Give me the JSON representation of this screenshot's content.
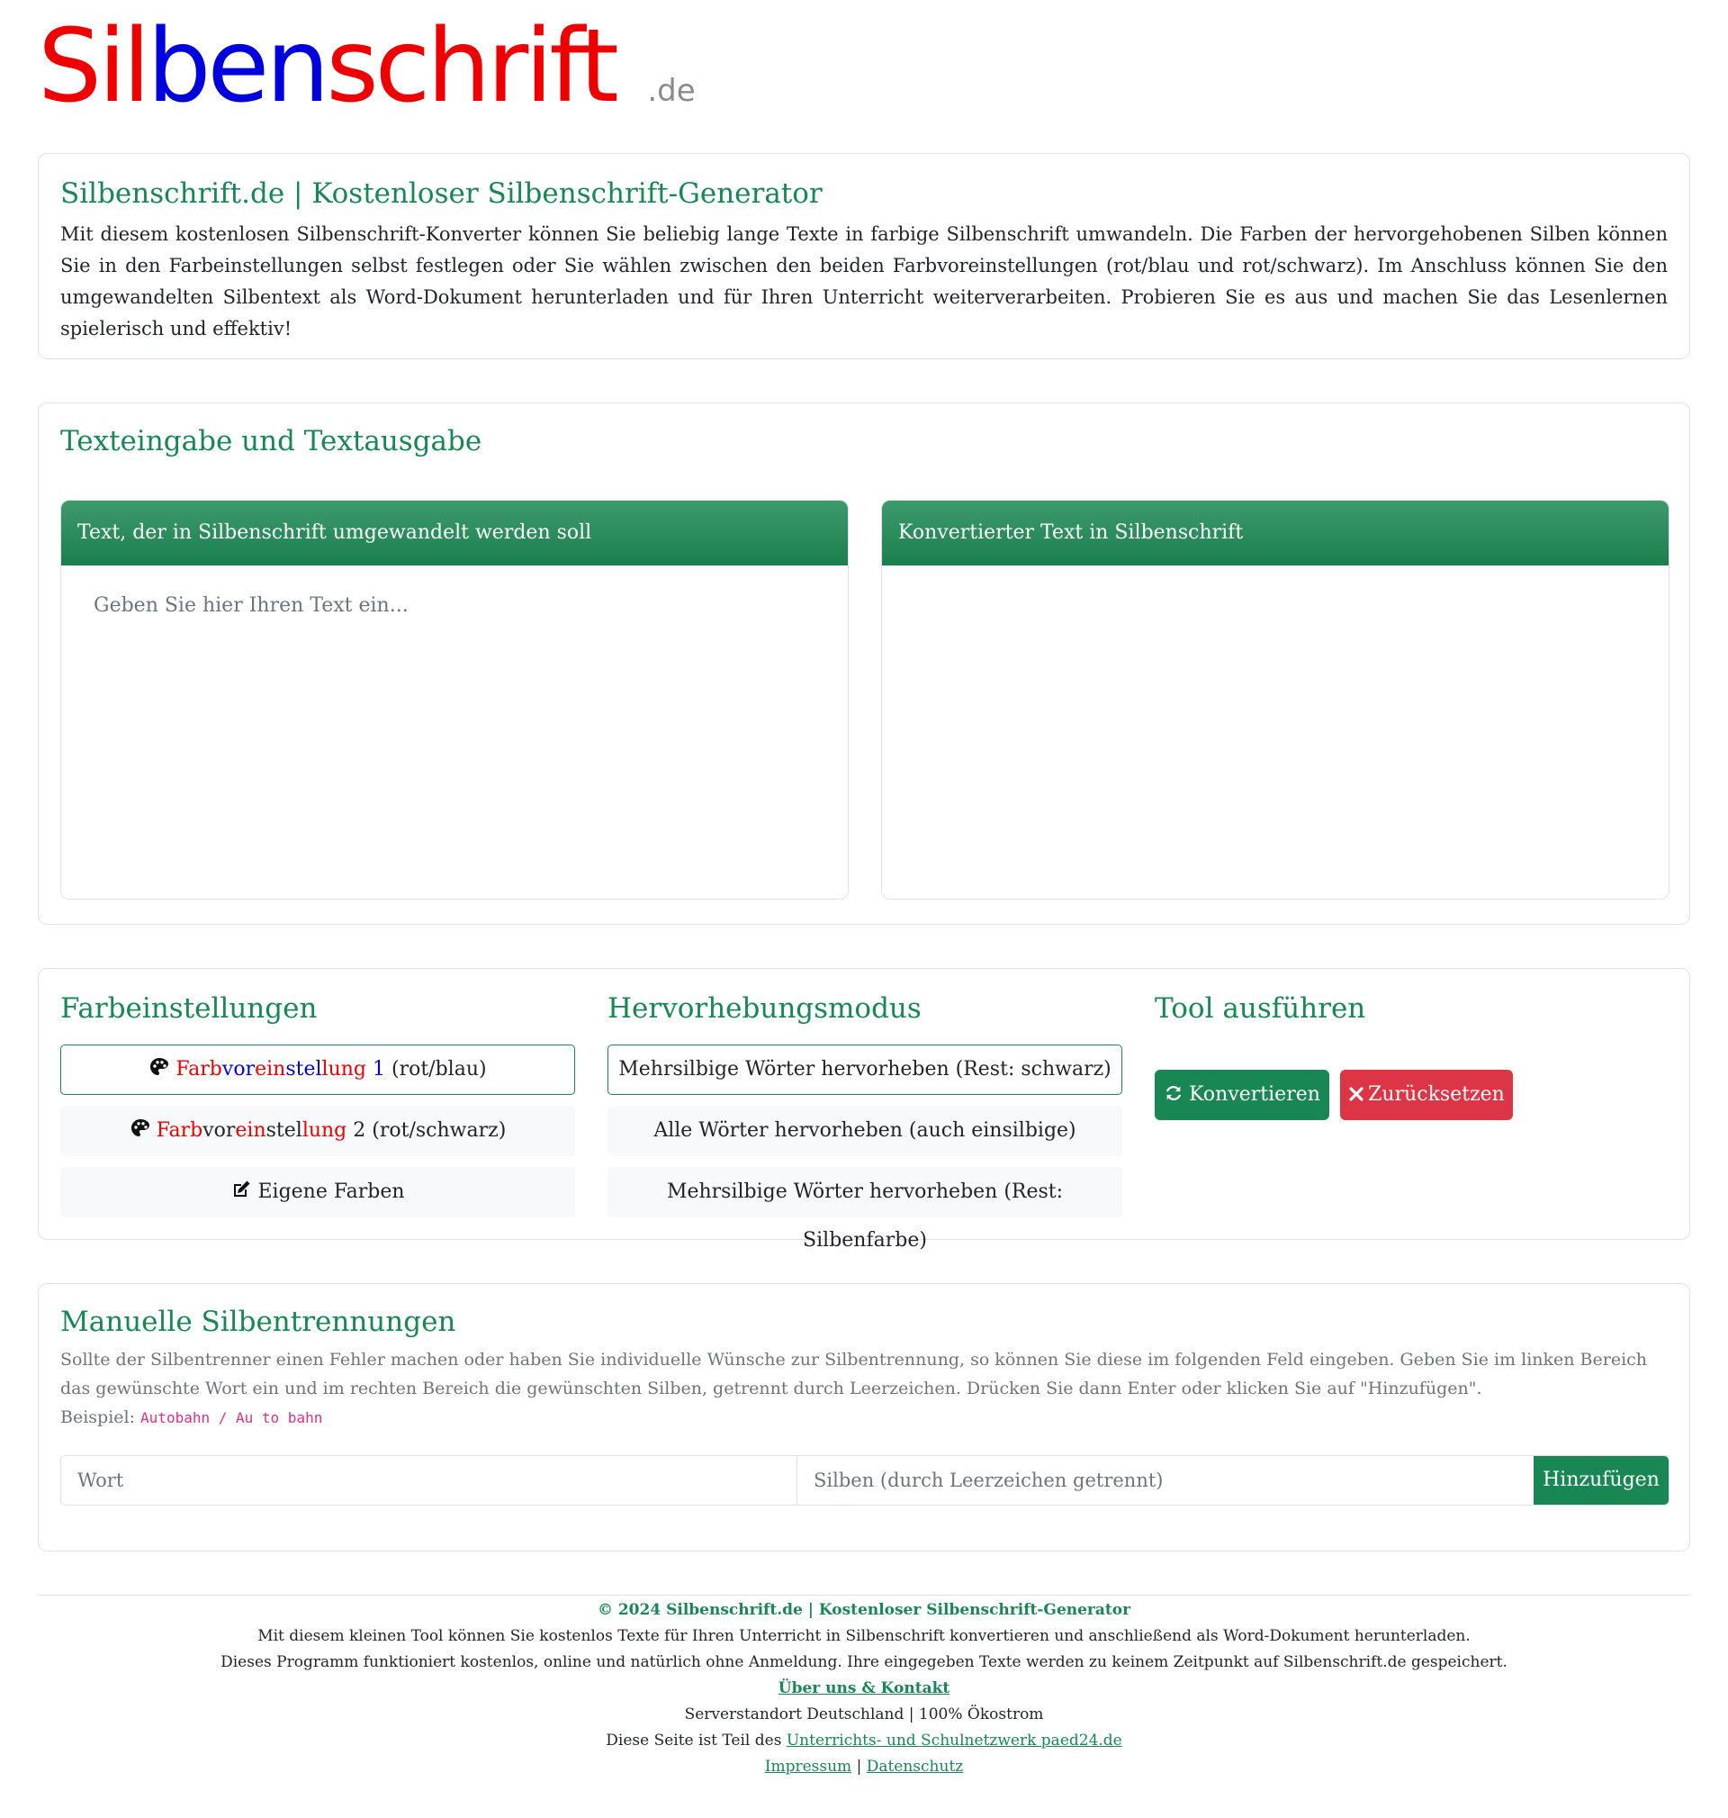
{
  "logo": {
    "syllables": [
      "Sil",
      "ben",
      "schrift"
    ],
    "tld": ".de"
  },
  "intro": {
    "title": "Silbenschrift.de | Kostenloser Silbenschrift-Generator",
    "text": "Mit diesem kostenlosen Silbenschrift-Konverter können Sie beliebig lange Texte in farbige Silbenschrift umwandeln. Die Farben der hervorgehobenen Silben können Sie in den Farbeinstellungen selbst festlegen oder Sie wählen zwischen den beiden Farbvoreinstellungen (rot/blau und rot/schwarz). Im Anschluss können Sie den umgewandelten Silbentext als Word-Dokument herunterladen und für Ihren Unterricht weiterverarbeiten. Probieren Sie es aus und machen Sie das Lesenlernen spielerisch und effektiv!"
  },
  "io": {
    "title": "Texteingabe und Textausgabe",
    "input_header": "Text, der in Silbenschrift umgewandelt werden soll",
    "input_placeholder": "Geben Sie hier Ihren Text ein...",
    "output_header": "Konvertierter Text in Silbenschrift",
    "output_text": ""
  },
  "colors": {
    "title": "Farbeinstellungen",
    "preset1": {
      "syllables": [
        "Farb",
        "vor",
        "ein",
        "stel",
        "lung"
      ],
      "num": "1",
      "suffix": "(rot/blau)"
    },
    "preset2": {
      "syllables": [
        "Farb",
        "vor",
        "ein",
        "stel",
        "lung"
      ],
      "num": "2",
      "suffix": "(rot/schwarz)"
    },
    "custom_label": "Eigene Farben",
    "selected": "preset1"
  },
  "highlight": {
    "title": "Hervorhebungsmodus",
    "options": [
      "Mehrsilbige Wörter hervorheben (Rest: schwarz)",
      "Alle Wörter hervorheben (auch einsilbige)",
      "Mehrsilbige Wörter hervorheben (Rest: Silbenfarbe)"
    ],
    "selected_index": 0
  },
  "run": {
    "title": "Tool ausführen",
    "convert_label": "Konvertieren",
    "reset_label": "Zurücksetzen"
  },
  "manual": {
    "title": "Manuelle Silbentrennungen",
    "description": "Sollte der Silbentrenner einen Fehler machen oder haben Sie individuelle Wünsche zur Silbentrennung, so können Sie diese im folgenden Feld eingeben. Geben Sie im linken Bereich das gewünschte Wort ein und im rechten Bereich die gewünschten Silben, getrennt durch Leerzeichen. Drücken Sie dann Enter oder klicken Sie auf \"Hinzufügen\".",
    "example_label": "Beispiel:",
    "example_code": "Autobahn / Au to bahn",
    "word_placeholder": "Wort",
    "syllables_placeholder": "Silben (durch Leerzeichen getrennt)",
    "add_label": "Hinzufügen"
  },
  "footer": {
    "copyright": "© 2024 Silbenschrift.de | Kostenloser Silbenschrift-Generator",
    "line1": "Mit diesem kleinen Tool können Sie kostenlos Texte für Ihren Unterricht in Silbenschrift konvertieren und anschließend als Word-Dokument herunterladen.",
    "line2": "Dieses Programm funktioniert kostenlos, online und natürlich ohne Anmeldung. Ihre eingegeben Texte werden zu keinem Zeitpunkt auf Silbenschrift.de gespeichert.",
    "about_link": "Über uns & Kontakt",
    "server": "Serverstandort Deutschland | 100% Ökostrom",
    "network_prefix": "Diese Seite ist Teil des",
    "network_link": "Unterrichts- und Schulnetzwerk paed24.de",
    "impressum": "Impressum",
    "separator": "|",
    "datenschutz": "Datenschutz"
  },
  "theme": {
    "accent": "#198754",
    "danger": "#dc3545",
    "syllable_red": "#ee0000",
    "syllable_blue": "#0000dd",
    "border": "#dee2e6"
  },
  "icons": {
    "palette": "palette-icon",
    "edit": "edit-icon",
    "refresh": "refresh-icon",
    "close": "close-icon"
  }
}
